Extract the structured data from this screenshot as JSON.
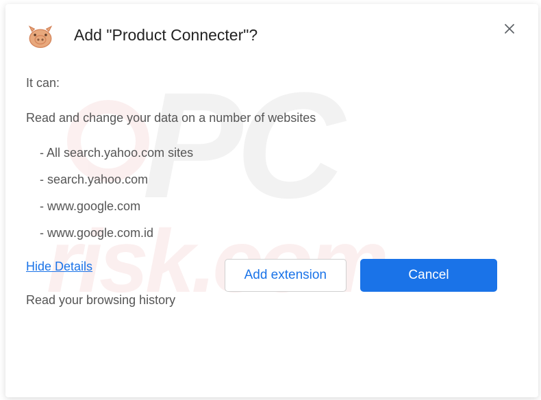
{
  "dialog": {
    "title": "Add \"Product Connecter\"?",
    "canLabel": "It can:",
    "permission1": "Read and change your data on a number of websites",
    "sites": [
      "- All search.yahoo.com sites",
      "- search.yahoo.com",
      "- www.google.com",
      "- www.google.com.id"
    ],
    "hideDetailsLabel": "Hide Details",
    "permission2": "Read your browsing history",
    "addButtonLabel": "Add extension",
    "cancelButtonLabel": "Cancel"
  }
}
